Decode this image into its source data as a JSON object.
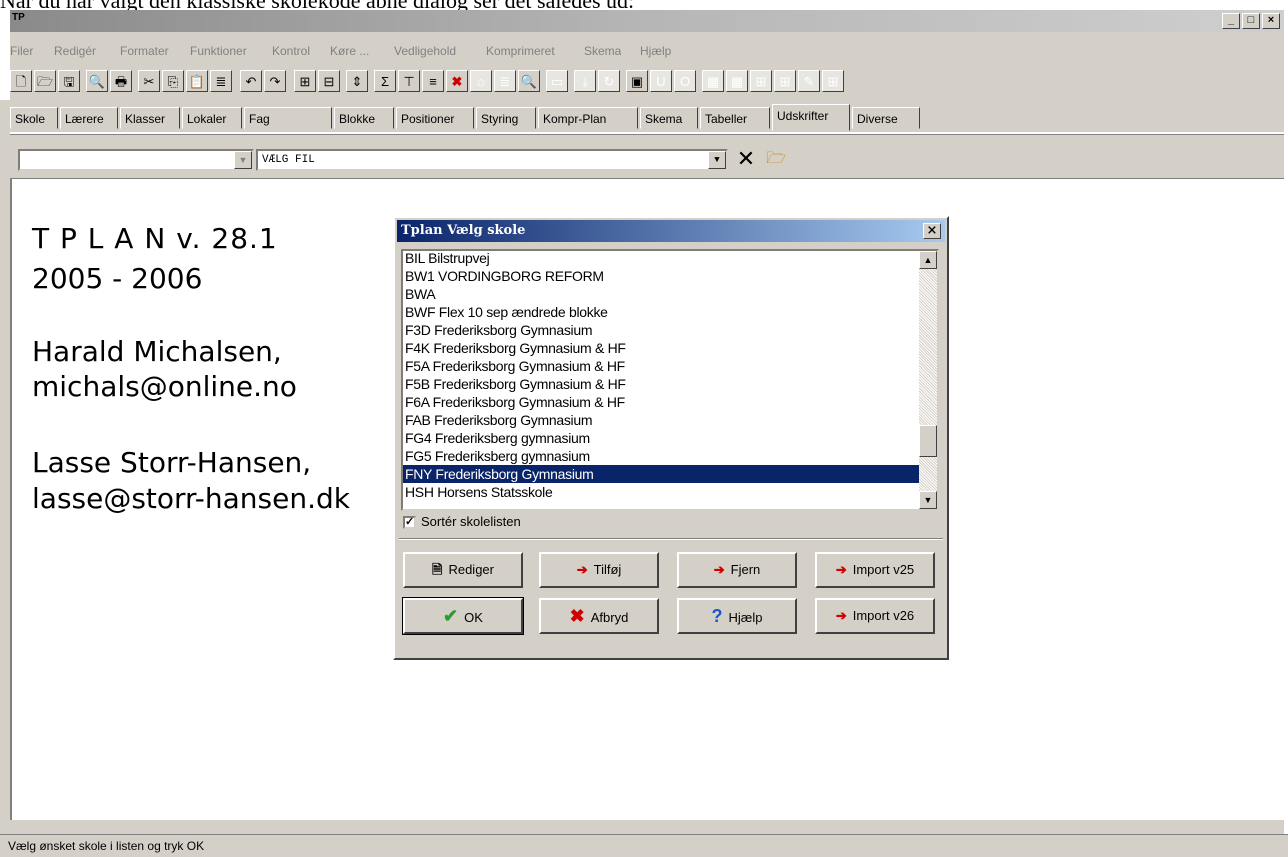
{
  "caption": "Når du har valgt den klassiske skolekode åbne dialog ser det således ud:",
  "app": {
    "logo": "TP"
  },
  "window_buttons": {
    "minimize": "_",
    "maximize": "□",
    "close": "×"
  },
  "menu": [
    "Filer",
    "Redigér",
    "Formater",
    "Funktioner",
    "Kontrol",
    "Køre ...",
    "Vedligehold",
    "Komprimeret",
    "Skema",
    "Hjælp"
  ],
  "tabs": [
    "Skole",
    "Lærere",
    "Klasser",
    "Lokaler",
    "Fag",
    "Blokke",
    "Positioner",
    "Styring",
    "Kompr-Plan",
    "Skema",
    "Tabeller",
    "Udskrifter",
    "Diverse"
  ],
  "active_tab": "Udskrifter",
  "file": {
    "combo1_value": "",
    "combo2_value": "VÆLG FIL",
    "clear_glyph": "✕"
  },
  "info": {
    "line1": "T P L A N   v. 28.1",
    "line2": "2005 - 2006",
    "line3": "Harald Michalsen,",
    "line4": "michals@online.no",
    "line5": "Lasse Storr-Hansen,",
    "line6": "lasse@storr-hansen.dk"
  },
  "dialog": {
    "title": "Tplan Vælg skole",
    "close": "×",
    "schools": [
      "BIL Bilstrupvej",
      "BW1 VORDINGBORG REFORM",
      "BWA",
      "BWF Flex 10 sep ændrede blokke",
      "F3D Frederiksborg Gymnasium",
      "F4K Frederiksborg Gymnasium & HF",
      "F5A Frederiksborg Gymnasium & HF",
      "F5B Frederiksborg Gymnasium & HF",
      "F6A Frederiksborg Gymnasium & HF",
      "FAB Frederiksborg Gymnasium",
      "FG4 Frederiksberg gymnasium",
      "FG5 Frederiksberg gymnasium",
      "FNY Frederiksborg Gymnasium",
      "HSH Horsens Statsskole"
    ],
    "selected_index": 12,
    "sort_label": "Sortér skolelisten",
    "sort_checked": true,
    "buttons": {
      "edit": "Rediger",
      "add": "Tilføj",
      "remove": "Fjern",
      "import25": "Import v25",
      "ok": "OK",
      "cancel": "Afbryd",
      "help": "Hjælp",
      "import26": "Import v26"
    }
  },
  "status": "Vælg ønsket skole i listen og tryk OK"
}
